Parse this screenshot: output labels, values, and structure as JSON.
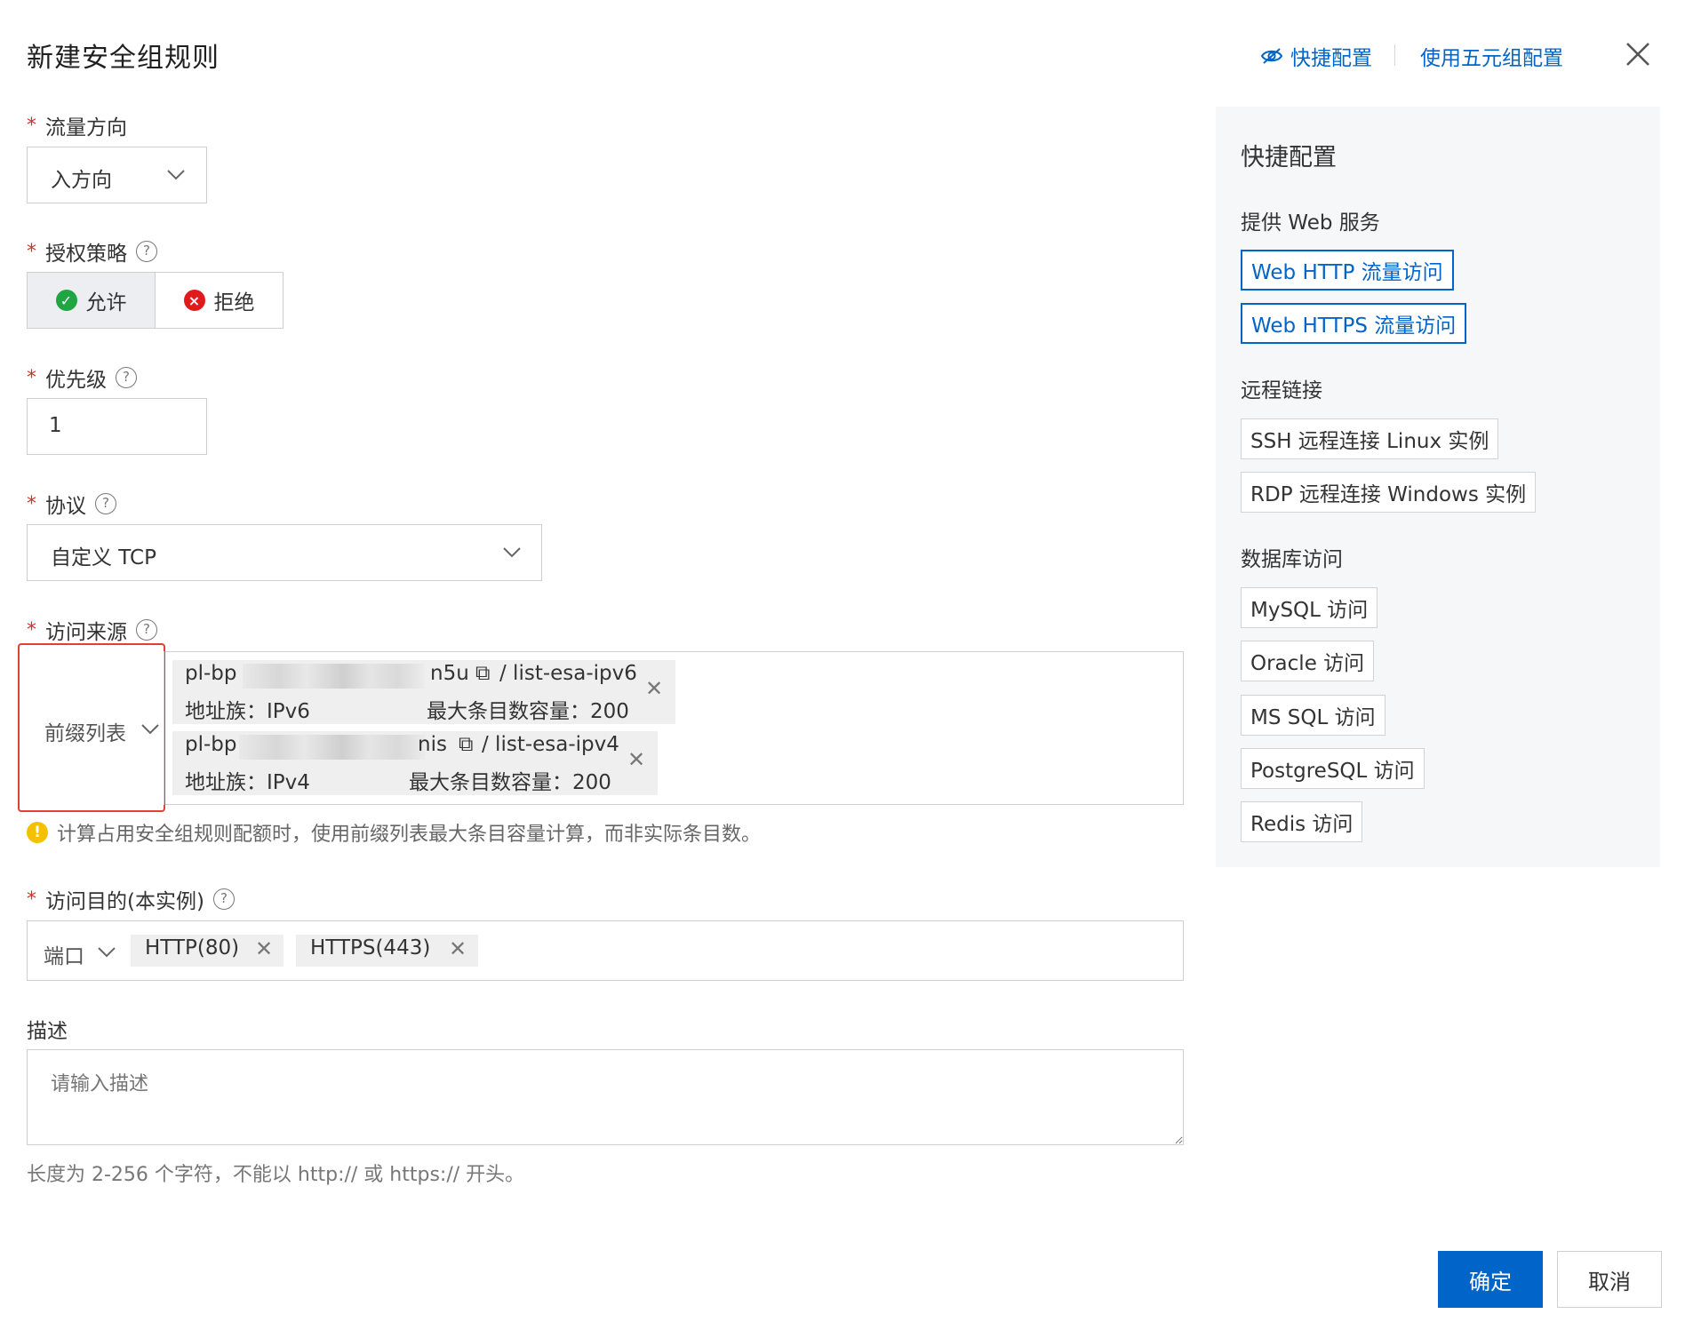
{
  "dialog": {
    "title": "新建安全组规则",
    "quick_config_link": "快捷配置",
    "five_tuple_link": "使用五元组配置"
  },
  "form": {
    "direction": {
      "label": "流量方向",
      "value": "入方向"
    },
    "policy": {
      "label": "授权策略",
      "allow": "允许",
      "deny": "拒绝",
      "selected": "允许"
    },
    "priority": {
      "label": "优先级",
      "value": "1"
    },
    "protocol": {
      "label": "协议",
      "value": "自定义 TCP"
    },
    "source": {
      "label": "访问来源",
      "type": "前缀列表",
      "tags": [
        {
          "id_prefix": "pl-bp",
          "id_suffix": "n5u",
          "name": "/ list-esa-ipv6",
          "family": "地址族：IPv6",
          "capacity": "最大条目数容量：200"
        },
        {
          "id_prefix": "pl-bp",
          "id_suffix": "nis",
          "name": "/ list-esa-ipv4",
          "family": "地址族：IPv4",
          "capacity": "最大条目数容量：200"
        }
      ],
      "warning": "计算占用安全组规则配额时，使用前缀列表最大条目容量计算，而非实际条目数。"
    },
    "destination": {
      "label": "访问目的(本实例)",
      "type": "端口",
      "ports": [
        "HTTP(80)",
        "HTTPS(443)"
      ]
    },
    "description": {
      "label": "描述",
      "placeholder": "请输入描述",
      "hint": "长度为 2-256 个字符，不能以 http:// 或 https:// 开头。"
    }
  },
  "quick_panel": {
    "title": "快捷配置",
    "groups": [
      {
        "title": "提供 Web 服务",
        "items": [
          "Web HTTP 流量访问",
          "Web HTTPS 流量访问"
        ]
      },
      {
        "title": "远程链接",
        "items": [
          "SSH 远程连接 Linux 实例",
          "RDP 远程连接 Windows 实例"
        ]
      },
      {
        "title": "数据库访问",
        "items": [
          "MySQL 访问",
          "Oracle 访问",
          "MS SQL 访问",
          "PostgreSQL 访问",
          "Redis 访问"
        ]
      }
    ]
  },
  "footer": {
    "ok": "确定",
    "cancel": "取消"
  },
  "colors": {
    "primary": "#0064c8",
    "required": "#d93026",
    "allow": "#1fa642",
    "deny": "#e01b1b",
    "highlight": "#e0422f",
    "warning": "#f5c000"
  }
}
